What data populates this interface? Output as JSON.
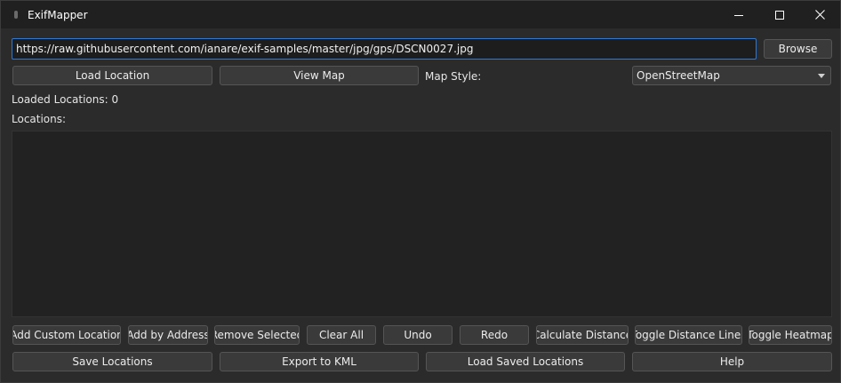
{
  "window": {
    "title": "ExifMapper"
  },
  "url_input": {
    "value": "https://raw.githubusercontent.com/ianare/exif-samples/master/jpg/gps/DSCN0027.jpg"
  },
  "buttons": {
    "browse": "Browse",
    "load_location": "Load Location",
    "view_map": "View Map",
    "add_custom_location": "Add Custom Location",
    "add_by_address": "Add by Address",
    "remove_selected": "Remove Selected",
    "clear_all": "Clear All",
    "undo": "Undo",
    "redo": "Redo",
    "calculate_distance": "Calculate Distance",
    "toggle_distance_lines": "Toggle Distance Lines",
    "toggle_heatmap": "Toggle Heatmap",
    "save_locations": "Save Locations",
    "export_kml": "Export to KML",
    "load_saved_locations": "Load Saved Locations",
    "help": "Help"
  },
  "map_style": {
    "label": "Map Style:",
    "selected": "OpenStreetMap"
  },
  "status": {
    "loaded_locations": "Loaded Locations: 0"
  },
  "locations": {
    "label": "Locations:",
    "items": []
  },
  "icons": {
    "app": "app-icon",
    "minimize": "minimize-icon",
    "maximize": "maximize-icon",
    "close": "close-icon",
    "dropdown": "chevron-down-icon"
  },
  "colors": {
    "window_bg": "#2b2b2b",
    "titlebar_bg": "#202020",
    "list_bg": "#222222",
    "input_focus_border": "#2f78d4"
  }
}
